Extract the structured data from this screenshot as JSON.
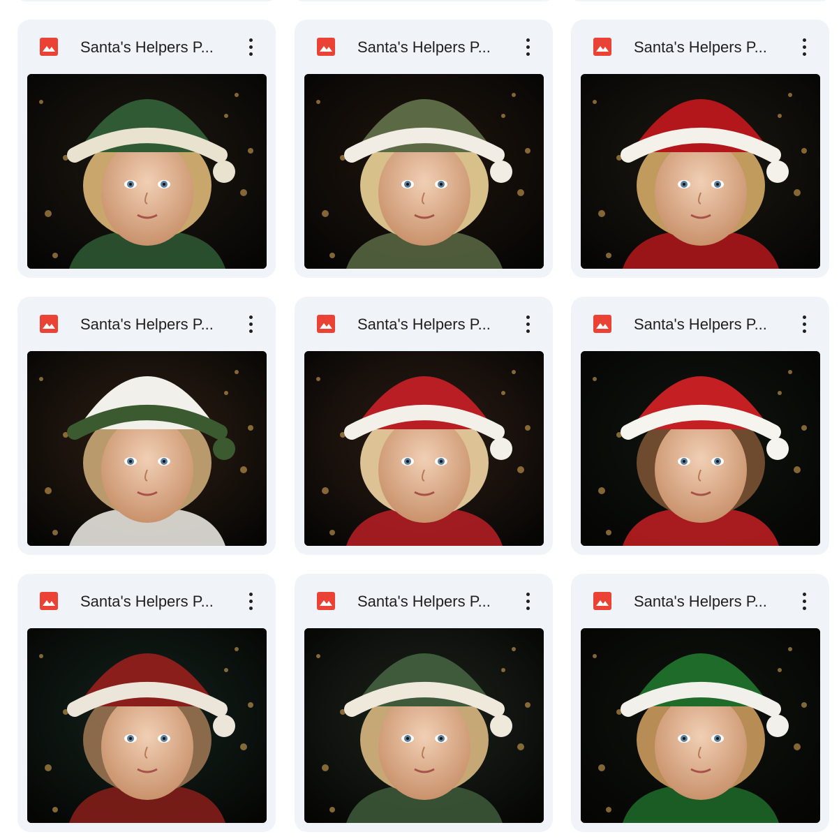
{
  "files": [
    {
      "title": "Santa's Helpers P...",
      "icon": "image-file-icon",
      "more_icon": "more-vert-icon",
      "thumbnail": "child-green-elf-hood",
      "hat_color": "#2f5a34",
      "trim_color": "#e9e2cf",
      "hair_color": "#c9a66b",
      "bg_color": "#1c1710"
    },
    {
      "title": "Santa's Helpers P...",
      "icon": "image-file-icon",
      "more_icon": "more-vert-icon",
      "thumbnail": "child-green-hat-fur-trim",
      "hat_color": "#5b6a44",
      "trim_color": "#f1ede4",
      "hair_color": "#d8c08a",
      "bg_color": "#1e140d"
    },
    {
      "title": "Santa's Helpers P...",
      "icon": "image-file-icon",
      "more_icon": "more-vert-icon",
      "thumbnail": "child-red-santa-hat",
      "hat_color": "#b3171b",
      "trim_color": "#f4f1ea",
      "hair_color": "#c19a5e",
      "bg_color": "#1a1710"
    },
    {
      "title": "Santa's Helpers P...",
      "icon": "image-file-icon",
      "more_icon": "more-vert-icon",
      "thumbnail": "child-white-hat-holly",
      "hat_color": "#f2f0ea",
      "trim_color": "#3c5a30",
      "hair_color": "#b99a6c",
      "bg_color": "#2b1d12"
    },
    {
      "title": "Santa's Helpers P...",
      "icon": "image-file-icon",
      "more_icon": "more-vert-icon",
      "thumbnail": "girl-red-hat-wreath",
      "hat_color": "#b81e24",
      "trim_color": "#f3f0ea",
      "hair_color": "#dcc294",
      "bg_color": "#2a1b13"
    },
    {
      "title": "Santa's Helpers P...",
      "icon": "image-file-icon",
      "more_icon": "more-vert-icon",
      "thumbnail": "child-red-santa-hat-smile",
      "hat_color": "#c41f22",
      "trim_color": "#f6f4ef",
      "hair_color": "#6e4b2e",
      "bg_color": "#0f130d"
    },
    {
      "title": "Santa's Helpers P...",
      "icon": "image-file-icon",
      "more_icon": "more-vert-icon",
      "thumbnail": "child-red-hood-fur",
      "hat_color": "#8a1e1a",
      "trim_color": "#ece6da",
      "hair_color": "#8a6a4a",
      "bg_color": "#12201a"
    },
    {
      "title": "Santa's Helpers P...",
      "icon": "image-file-icon",
      "more_icon": "more-vert-icon",
      "thumbnail": "child-green-elf-hat-pearls",
      "hat_color": "#3e5a3a",
      "trim_color": "#efe9dc",
      "hair_color": "#c6a877",
      "bg_color": "#1b2119"
    },
    {
      "title": "Santa's Helpers P...",
      "icon": "image-file-icon",
      "more_icon": "more-vert-icon",
      "thumbnail": "child-green-elf-hat-pompom",
      "hat_color": "#1f6b2a",
      "trim_color": "#f2f0ea",
      "hair_color": "#b88c55",
      "bg_color": "#0e120c"
    }
  ]
}
